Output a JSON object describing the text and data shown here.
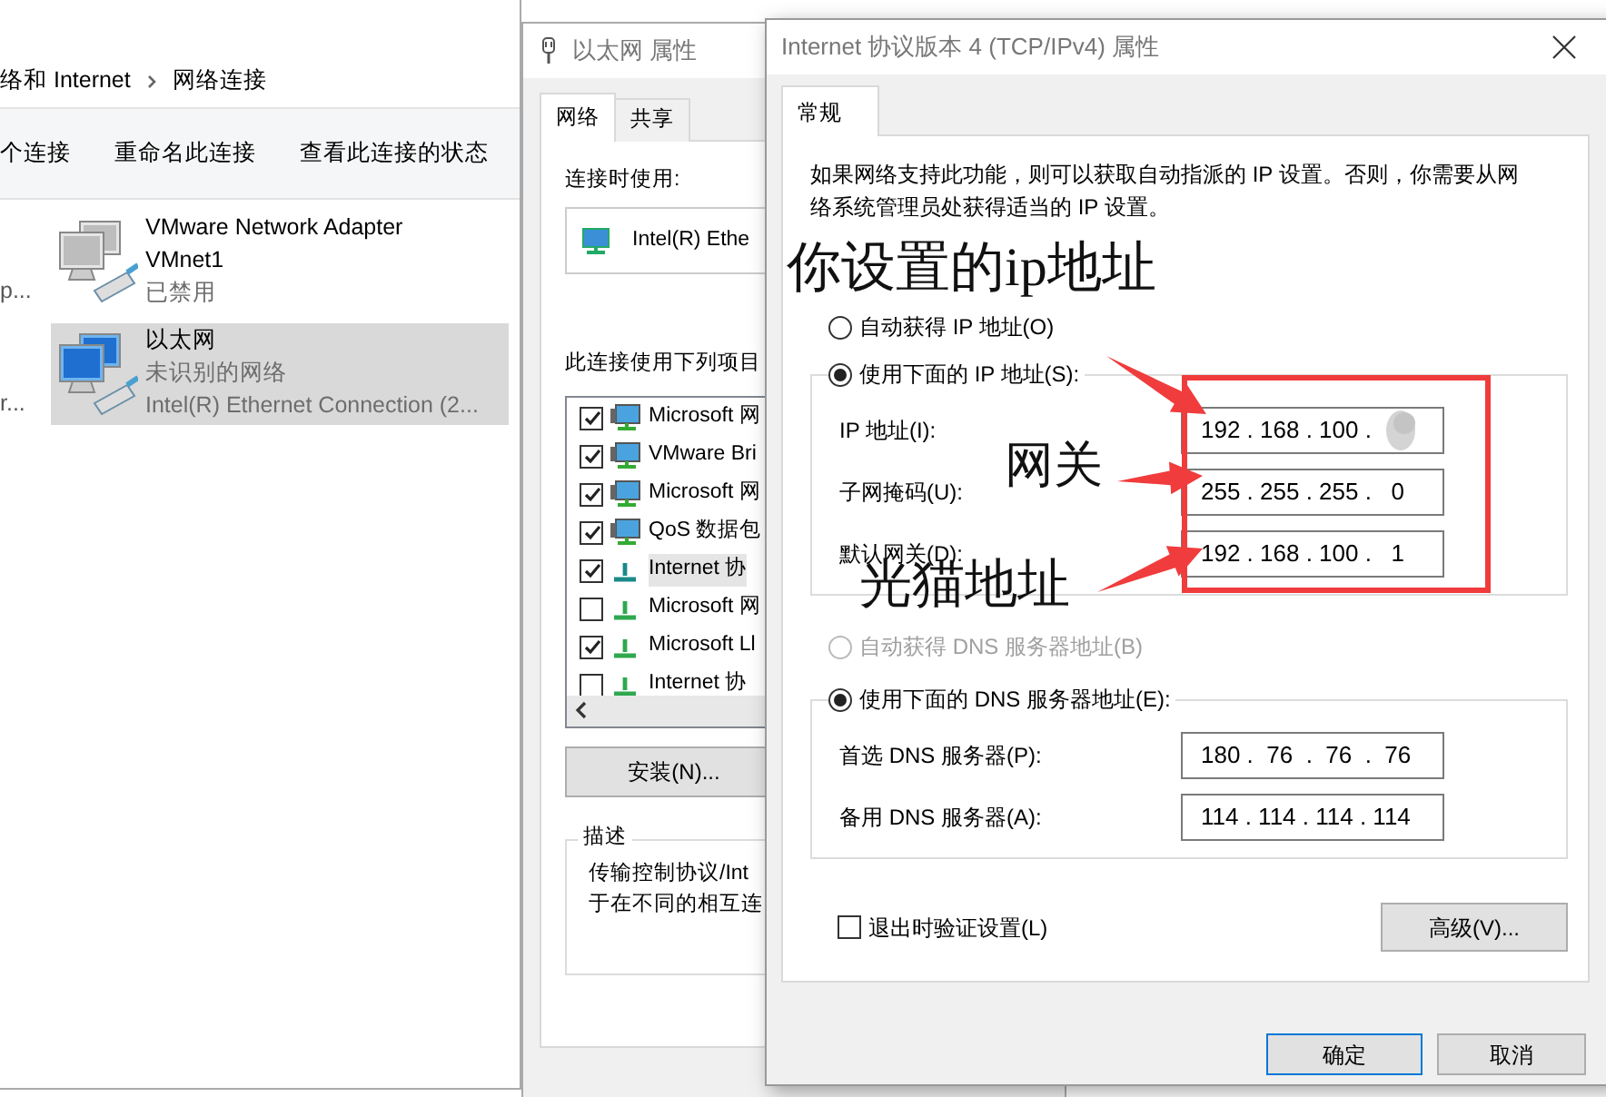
{
  "explorer": {
    "breadcrumb": [
      {
        "label": "络和 Internet"
      },
      {
        "label": "网络连接"
      }
    ],
    "toolbar": [
      "个连接",
      "重命名此连接",
      "查看此连接的状态"
    ],
    "connections": [
      {
        "column_1": "p...",
        "name": "VMware Network Adapter VMnet1",
        "status": "已禁用",
        "disabled": true,
        "selected": false
      },
      {
        "column_1": "r...",
        "name": "以太网",
        "status": "未识别的网络",
        "device": "Intel(R) Ethernet Connection (2...",
        "disabled": false,
        "selected": true
      }
    ]
  },
  "ethernet_properties": {
    "title": "以太网 属性",
    "tabs": [
      {
        "label": "网络",
        "selected": true
      },
      {
        "label": "共享",
        "selected": false
      }
    ],
    "connect_using_label": "连接时使用:",
    "adapter": "Intel(R) Ethe",
    "items_label": "此连接使用下列项目",
    "items": [
      {
        "label": "Microsoft 网",
        "checked": true,
        "kind": "service",
        "selected": false
      },
      {
        "label": "VMware Bri",
        "checked": true,
        "kind": "service",
        "selected": false
      },
      {
        "label": "Microsoft 网",
        "checked": true,
        "kind": "service",
        "selected": false
      },
      {
        "label": "QoS 数据包",
        "checked": true,
        "kind": "service",
        "selected": false
      },
      {
        "label": "Internet 协",
        "checked": true,
        "kind": "protocol",
        "selected": true
      },
      {
        "label": "Microsoft 网",
        "checked": false,
        "kind": "protocol",
        "selected": false
      },
      {
        "label": "Microsoft Ll",
        "checked": true,
        "kind": "protocol",
        "selected": false
      },
      {
        "label": "Internet 协",
        "checked": false,
        "kind": "protocol",
        "selected": false
      }
    ],
    "install_button": "安装(N)...",
    "description_label": "描述",
    "description_lines": [
      "传输控制协议/Int",
      "于在不同的相互连"
    ]
  },
  "ipv4_properties": {
    "title": "Internet 协议版本 4 (TCP/IPv4) 属性",
    "tabs": [
      {
        "label": "常规",
        "selected": true
      }
    ],
    "intro": "如果网络支持此功能，则可以获取自动指派的 IP 设置。否则，你需要从网络系统管理员处获得适当的 IP 设置。",
    "ip_auto": {
      "label": "自动获得 IP 地址(O)",
      "selected": false,
      "disabled": false
    },
    "ip_manual": {
      "label": "使用下面的 IP 地址(S):",
      "selected": true,
      "fields": [
        {
          "label": "IP 地址(I):",
          "value": "192 . 168 . 100 .",
          "redacted": true
        },
        {
          "label": "子网掩码(U):",
          "value": "255 . 255 . 255 .   0"
        },
        {
          "label": "默认网关(D):",
          "value": "192 . 168 . 100 .   1"
        }
      ]
    },
    "dns_auto": {
      "label": "自动获得 DNS 服务器地址(B)",
      "selected": false,
      "disabled": true
    },
    "dns_manual": {
      "label": "使用下面的 DNS 服务器地址(E):",
      "selected": true,
      "fields": [
        {
          "label": "首选 DNS 服务器(P):",
          "value": "180 .  76  .  76  .  76"
        },
        {
          "label": "备用 DNS 服务器(A):",
          "value": "114 . 114 . 114 . 114"
        }
      ]
    },
    "validate": {
      "label": "退出时验证设置(L)",
      "checked": false
    },
    "advanced_button": "高级(V)...",
    "ok_button": "确定",
    "cancel_button": "取消"
  },
  "annotations": [
    {
      "text": "你设置的ip地址"
    },
    {
      "text": "网关"
    },
    {
      "text": "光猫地址"
    }
  ]
}
